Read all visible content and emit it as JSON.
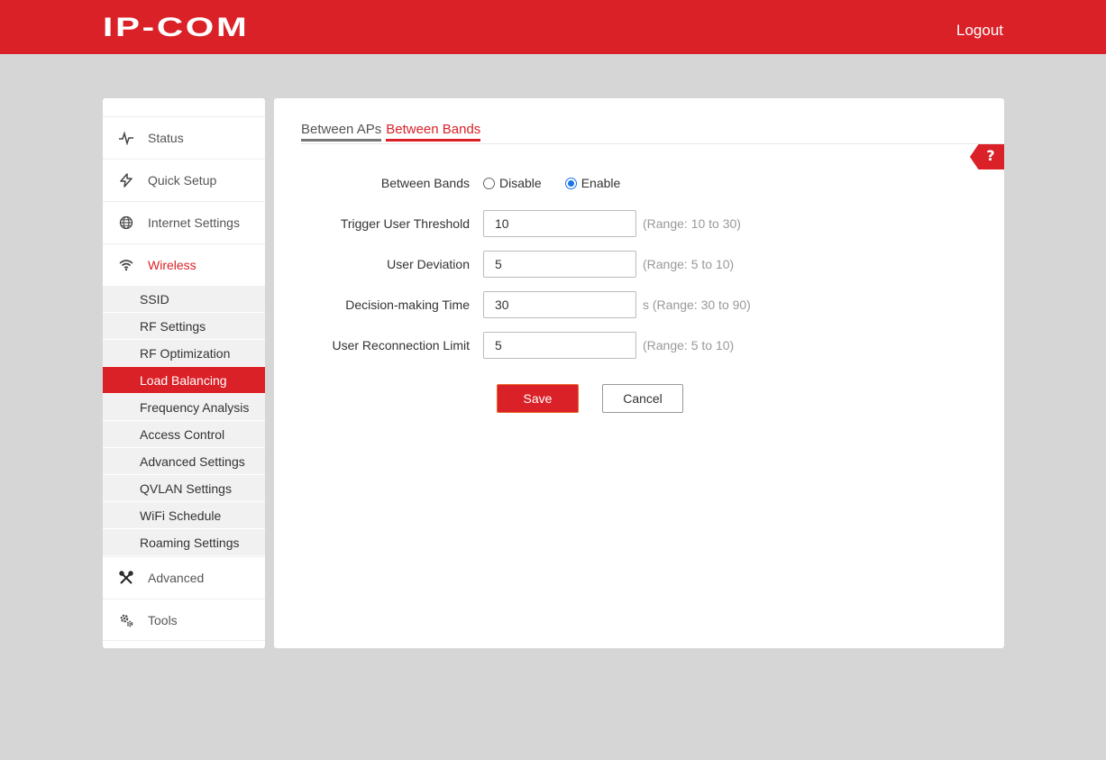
{
  "header": {
    "logo_text": "IP-COM",
    "logout_label": "Logout",
    "brand_color": "#da2128"
  },
  "sidebar": {
    "main_items": [
      {
        "label": "Status",
        "icon": "pulse-icon"
      },
      {
        "label": "Quick Setup",
        "icon": "lightning-icon"
      },
      {
        "label": "Internet Settings",
        "icon": "globe-icon"
      },
      {
        "label": "Wireless",
        "icon": "wifi-icon",
        "active": true
      },
      {
        "label": "Advanced",
        "icon": "tools-icon"
      },
      {
        "label": "Tools",
        "icon": "gears-icon"
      }
    ],
    "wireless_sub_items": [
      "SSID",
      "RF Settings",
      "RF Optimization",
      "Load Balancing",
      "Frequency Analysis",
      "Access Control",
      "Advanced Settings",
      "QVLAN Settings",
      "WiFi Schedule",
      "Roaming Settings"
    ],
    "active_sub_item": "Load Balancing"
  },
  "panel": {
    "tabs": [
      {
        "label": "Between APs",
        "active": false
      },
      {
        "label": "Between Bands",
        "active": true
      }
    ],
    "help_label": "?",
    "form": {
      "between_bands": {
        "label": "Between Bands",
        "options": [
          "Disable",
          "Enable"
        ],
        "selected": "Enable"
      },
      "trigger_user_threshold": {
        "label": "Trigger User Threshold",
        "value": "10",
        "hint": "(Range: 10 to 30)"
      },
      "user_deviation": {
        "label": "User Deviation",
        "value": "5",
        "hint": "(Range: 5 to 10)"
      },
      "decision_making_time": {
        "label": "Decision-making Time",
        "value": "30",
        "hint": "s (Range: 30 to 90)"
      },
      "user_reconnection_limit": {
        "label": "User Reconnection Limit",
        "value": "5",
        "hint": "(Range: 5 to 10)"
      }
    },
    "save_label": "Save",
    "cancel_label": "Cancel"
  }
}
